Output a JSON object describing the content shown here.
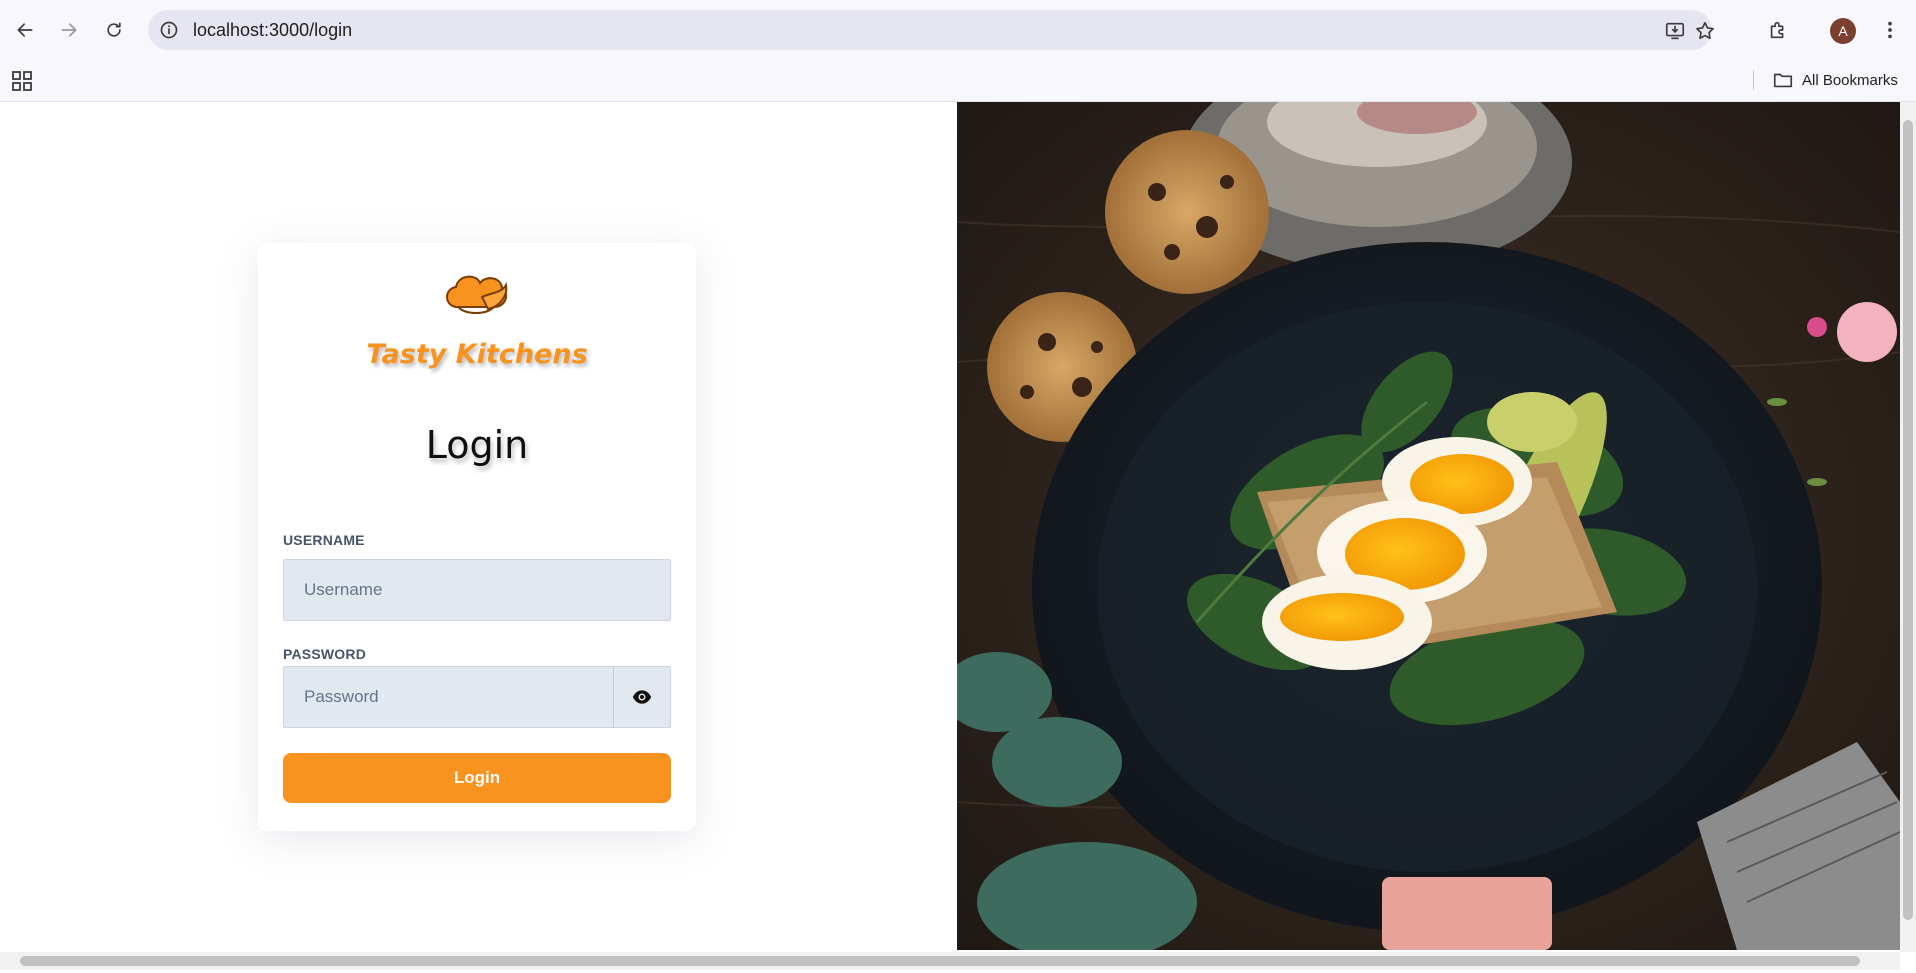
{
  "browser": {
    "url": "localhost:3000/login",
    "avatar_initial": "A",
    "bookmarks_label": "All Bookmarks"
  },
  "card": {
    "brand": "Tasty Kitchens",
    "heading": "Login",
    "username_label": "USERNAME",
    "username_placeholder": "Username",
    "username_value": "",
    "password_label": "PASSWORD",
    "password_placeholder": "Password",
    "password_value": "",
    "login_button": "Login"
  },
  "colors": {
    "brand_orange": "#f7931e",
    "input_bg": "#e2e8f0",
    "label_text": "#475569"
  },
  "hero": {
    "image_subject": "food-photo"
  }
}
